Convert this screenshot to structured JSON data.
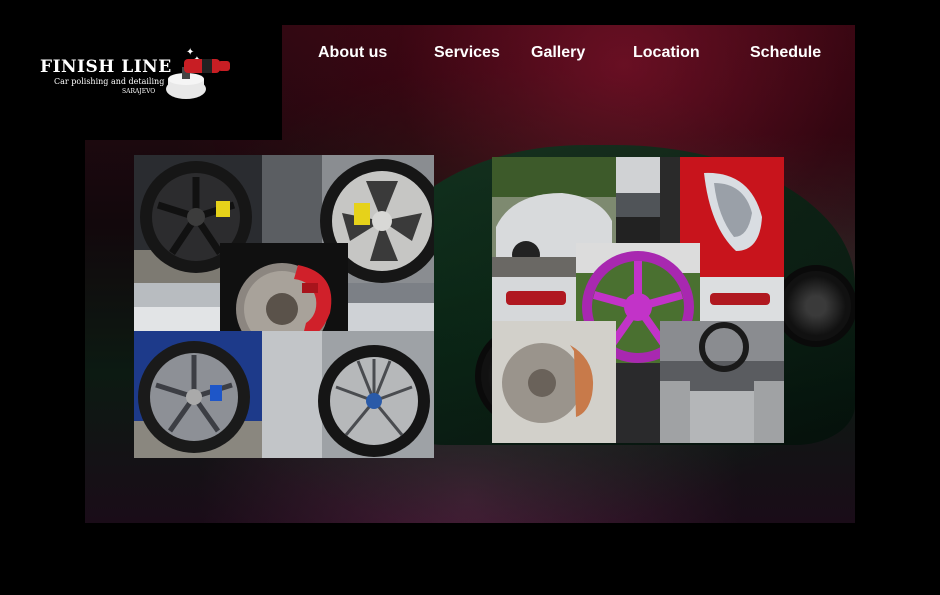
{
  "brand": {
    "name": "FINISH LINE",
    "tagline": "Car polishing and detailing",
    "city": "SARAJEVO",
    "logo_icon": "polisher-icon"
  },
  "nav": {
    "items": [
      {
        "label": "About us"
      },
      {
        "label": "Services"
      },
      {
        "label": "Gallery"
      },
      {
        "label": "Location"
      },
      {
        "label": "Schedule"
      }
    ]
  },
  "colors": {
    "background": "#000000",
    "nav_text": "#ffffff",
    "caliper_red": "#d0202a",
    "rim_magenta": "#c233c8",
    "caliper_yellow": "#e6d21a"
  },
  "gallery": {
    "left_collage_icon": "wheels-collage-image",
    "right_collage_icon": "detailing-collage-image"
  }
}
